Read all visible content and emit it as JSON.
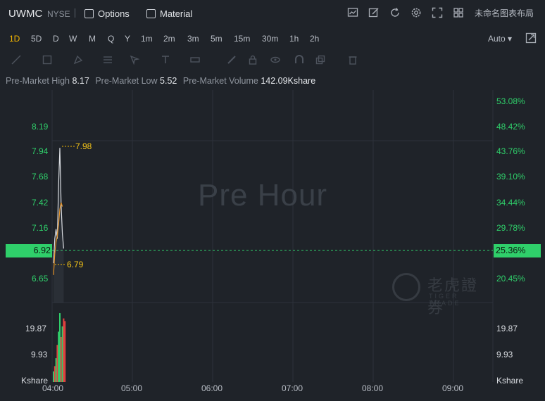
{
  "header": {
    "symbol": "UWMC",
    "exchange": "NYSE",
    "options_label": "Options",
    "material_label": "Material",
    "layout_name": "未命名图表布局"
  },
  "periods": [
    "1D",
    "5D",
    "D",
    "W",
    "M",
    "Q",
    "Y",
    "1m",
    "2m",
    "3m",
    "5m",
    "15m",
    "30m",
    "1h",
    "2h"
  ],
  "active_period": "1D",
  "scale_mode": "Auto",
  "stats": {
    "high_label": "Pre-Market High",
    "high_value": "8.17",
    "low_label": "Pre-Market Low",
    "low_value": "5.52",
    "volume_label": "Pre-Market Volume",
    "volume_value": "142.09Kshare"
  },
  "chart_data": {
    "type": "line",
    "watermark": "Pre Hour",
    "price_axis_labels": [
      "8.19",
      "7.94",
      "7.68",
      "7.42",
      "7.16",
      "6.92",
      "6.65"
    ],
    "percent_axis_labels": [
      "53.08%",
      "48.42%",
      "43.76%",
      "39.10%",
      "34.44%",
      "29.78%",
      "25.36%",
      "20.45%"
    ],
    "volume_axis_labels": [
      "19.87",
      "9.93",
      "Kshare"
    ],
    "time_labels": [
      "04:00",
      "05:00",
      "06:00",
      "07:00",
      "08:00",
      "09:00"
    ],
    "current_price": "6.92",
    "current_percent": "25.36%",
    "high_annotation": "7.98",
    "low_annotation": "6.79",
    "ylim": [
      6.5,
      8.3
    ],
    "price_series": [
      {
        "t": 0.0,
        "v": 6.8
      },
      {
        "t": 0.01,
        "v": 7.05
      },
      {
        "t": 0.02,
        "v": 7.15
      },
      {
        "t": 0.03,
        "v": 7.05
      },
      {
        "t": 0.04,
        "v": 7.6
      },
      {
        "t": 0.05,
        "v": 7.98
      },
      {
        "t": 0.06,
        "v": 7.4
      },
      {
        "t": 0.07,
        "v": 7.1
      },
      {
        "t": 0.08,
        "v": 6.95
      }
    ],
    "avg_series": [
      {
        "t": 0.0,
        "v": 6.68
      },
      {
        "t": 0.01,
        "v": 6.9
      },
      {
        "t": 0.02,
        "v": 7.02
      },
      {
        "t": 0.03,
        "v": 7.08
      },
      {
        "t": 0.04,
        "v": 7.2
      },
      {
        "t": 0.05,
        "v": 7.35
      },
      {
        "t": 0.06,
        "v": 7.42
      },
      {
        "t": 0.07,
        "v": 7.38
      }
    ],
    "volume_ylim": [
      0,
      30
    ],
    "volume_bars": [
      {
        "t": 0.0,
        "v": 4,
        "dir": "up"
      },
      {
        "t": 0.006,
        "v": 6,
        "dir": "down"
      },
      {
        "t": 0.012,
        "v": 9,
        "dir": "up"
      },
      {
        "t": 0.018,
        "v": 14,
        "dir": "down"
      },
      {
        "t": 0.024,
        "v": 19,
        "dir": "up"
      },
      {
        "t": 0.03,
        "v": 26,
        "dir": "up"
      },
      {
        "t": 0.036,
        "v": 17,
        "dir": "down"
      },
      {
        "t": 0.042,
        "v": 21,
        "dir": "up"
      },
      {
        "t": 0.048,
        "v": 24,
        "dir": "down"
      },
      {
        "t": 0.054,
        "v": 23,
        "dir": "down"
      }
    ]
  },
  "colors": {
    "up": "#2fcf6a",
    "down": "#e5413f",
    "price_line": "#d9dce1",
    "avg_line": "#e6952b",
    "accent": "#f5b700"
  }
}
